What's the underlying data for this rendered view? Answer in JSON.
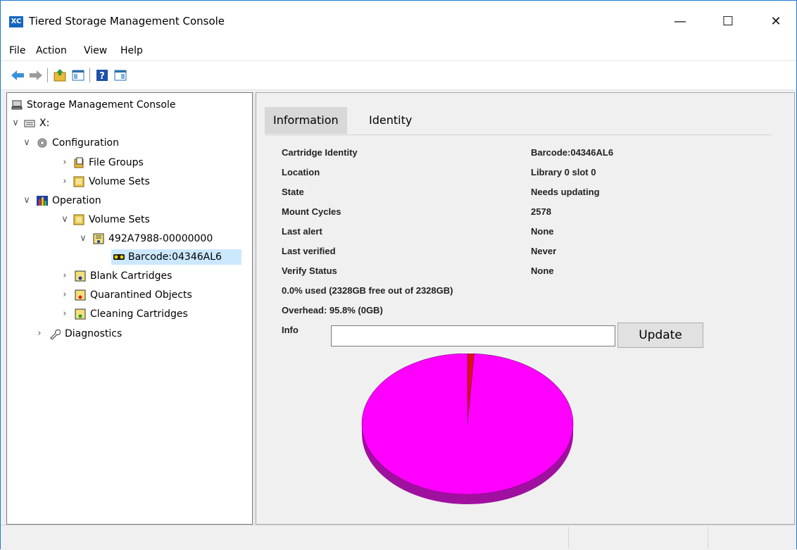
{
  "window": {
    "app_icon_text": "XC",
    "title": "Tiered Storage Management Console",
    "minimize": "—",
    "maximize": "☐",
    "close": "✕"
  },
  "menu": [
    "File",
    "Action",
    "View",
    "Help"
  ],
  "toolbar": {
    "icons": [
      "back-arrow-icon",
      "forward-arrow-icon",
      "folder-up-icon",
      "show-hide-tree-icon",
      "help-icon",
      "action-pane-icon"
    ]
  },
  "tree": {
    "root": "Storage Management Console",
    "drive": "X:",
    "configuration": "Configuration",
    "file_groups": "File Groups",
    "config_volume_sets": "Volume Sets",
    "operation": "Operation",
    "op_volume_sets": "Volume Sets",
    "volume_set_id": "492A7988-00000000",
    "barcode": "Barcode:04346AL6",
    "blank_cartridges": "Blank Cartridges",
    "quarantined_objects": "Quarantined Objects",
    "cleaning_cartridges": "Cleaning Cartridges",
    "diagnostics": "Diagnostics",
    "expander_expanded": "∨",
    "expander_collapsed": "›"
  },
  "tabs": [
    "Information",
    "Identity"
  ],
  "info": {
    "rows": [
      {
        "label": "Cartridge Identity",
        "value": "Barcode:04346AL6"
      },
      {
        "label": "Location",
        "value": "Library 0 slot 0"
      },
      {
        "label": "State",
        "value": "Needs updating"
      },
      {
        "label": "Mount Cycles",
        "value": "2578"
      },
      {
        "label": "Last alert",
        "value": "None"
      },
      {
        "label": "Last verified",
        "value": "Never"
      },
      {
        "label": "Verify Status",
        "value": "None"
      }
    ],
    "usage": "0.0% used (2328GB free out of 2328GB)",
    "overhead": "Overhead: 95.8% (0GB)",
    "info_label": "Info",
    "info_value": "",
    "update_label": "Update"
  },
  "chart_data": {
    "type": "pie",
    "slices": [
      {
        "value": 1,
        "color": "#e01010"
      },
      {
        "value": 99,
        "color": "#ff00ff"
      }
    ],
    "side_color": "#a0109f"
  }
}
